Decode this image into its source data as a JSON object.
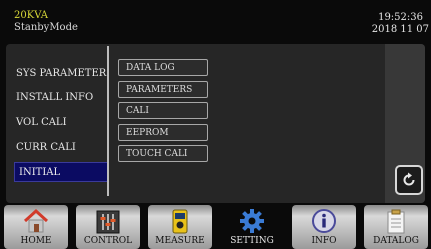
{
  "status": {
    "model": "20KVA",
    "mode": "StanbyMode",
    "time": "19:52:36",
    "date": "2018 11 07"
  },
  "left_menu": {
    "items": [
      {
        "label": "SYS PARAMETER"
      },
      {
        "label": "INSTALL INFO"
      },
      {
        "label": "VOL CALI"
      },
      {
        "label": "CURR CALI"
      },
      {
        "label": "INITIAL",
        "selected": true
      }
    ]
  },
  "sub_menu": {
    "items": [
      {
        "label": "DATA LOG"
      },
      {
        "label": "PARAMETERS"
      },
      {
        "label": "CALI"
      },
      {
        "label": "EEPROM"
      },
      {
        "label": "TOUCH CALI"
      }
    ]
  },
  "back_button": {
    "icon": "refresh-back-icon"
  },
  "nav": {
    "active": "SETTING",
    "tabs": [
      {
        "label": "HOME",
        "icon": "house-icon"
      },
      {
        "label": "CONTROL",
        "icon": "sliders-icon"
      },
      {
        "label": "MEASURE",
        "icon": "meter-icon"
      },
      {
        "label": "SETTING",
        "icon": "gear-icon"
      },
      {
        "label": "INFO",
        "icon": "info-icon"
      },
      {
        "label": "DATALOG",
        "icon": "clipboard-icon"
      }
    ]
  },
  "colors": {
    "model_text": "#d8d838",
    "selected_item_bg": "#0b0b62",
    "panel_bg": "#262626",
    "background": "#0a0a0a"
  }
}
